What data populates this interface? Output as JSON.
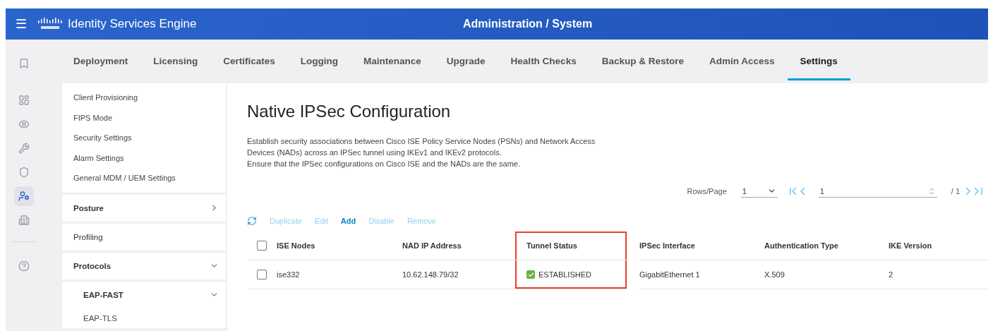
{
  "header": {
    "menu_glyph": "☰",
    "product": "Identity Services Engine",
    "title": "Administration / System"
  },
  "rail": [
    {
      "selected": false
    },
    {
      "selected": false
    },
    {
      "selected": false
    },
    {
      "selected": false
    },
    {
      "selected": false
    },
    {
      "selected": true
    },
    {
      "selected": false
    },
    {
      "selected": false
    }
  ],
  "tabs": [
    {
      "label": "Deployment",
      "selected": false
    },
    {
      "label": "Licensing",
      "selected": false
    },
    {
      "label": "Certificates",
      "selected": false
    },
    {
      "label": "Logging",
      "selected": false
    },
    {
      "label": "Maintenance",
      "selected": false
    },
    {
      "label": "Upgrade",
      "selected": false
    },
    {
      "label": "Health Checks",
      "selected": false
    },
    {
      "label": "Backup & Restore",
      "selected": false
    },
    {
      "label": "Admin Access",
      "selected": false
    },
    {
      "label": "Settings",
      "selected": true
    }
  ],
  "sidebar": [
    {
      "kind": "links",
      "items": [
        "Client Provisioning",
        "FIPS Mode",
        "Security Settings",
        "Alarm Settings",
        "General MDM / UEM Settings"
      ]
    },
    {
      "kind": "section",
      "label": "Posture",
      "bold": true,
      "expanded": false
    },
    {
      "kind": "section",
      "label": "Profiling",
      "bold": false
    },
    {
      "kind": "section",
      "label": "Protocols",
      "bold": true,
      "expanded": true
    },
    {
      "kind": "group",
      "label": "EAP-FAST",
      "expanded": true,
      "children": [
        "EAP-TLS"
      ]
    }
  ],
  "page": {
    "title": "Native IPSec Configuration",
    "description": [
      "Establish security associations between Cisco ISE Policy Service Nodes (PSNs) and Network Access",
      "Devices (NADs) across an IPSec tunnel using IKEv1 and IKEv2 protocols.",
      "Ensure that the IPSec configurations on Cisco ISE and the NADs are the same."
    ]
  },
  "pagination": {
    "rows_label": "Rows/Page",
    "rows_value": "1",
    "page_value": "1",
    "total": "/ 1"
  },
  "actions": [
    {
      "label": "Duplicate",
      "disabled": true
    },
    {
      "label": "Edit",
      "disabled": true
    },
    {
      "label": "Add",
      "disabled": false
    },
    {
      "label": "Disable",
      "disabled": true
    },
    {
      "label": "Remove",
      "disabled": true
    }
  ],
  "table": {
    "all_checked": false,
    "columns": [
      {
        "label": "ISE Nodes",
        "highlighted": false
      },
      {
        "label": "NAD IP Address",
        "highlighted": false
      },
      {
        "label": "Tunnel Status",
        "highlighted": true
      },
      {
        "label": "IPSec Interface",
        "highlighted": false
      },
      {
        "label": "Authentication Type",
        "highlighted": false
      },
      {
        "label": "IKE Version",
        "highlighted": false
      }
    ],
    "rows": [
      {
        "checked": false,
        "cells": [
          "ise332",
          "10.62.148.79/32",
          "ESTABLISHED",
          "GigabitEthernet 1",
          "X.509",
          "2"
        ],
        "status_ok": true
      }
    ]
  }
}
